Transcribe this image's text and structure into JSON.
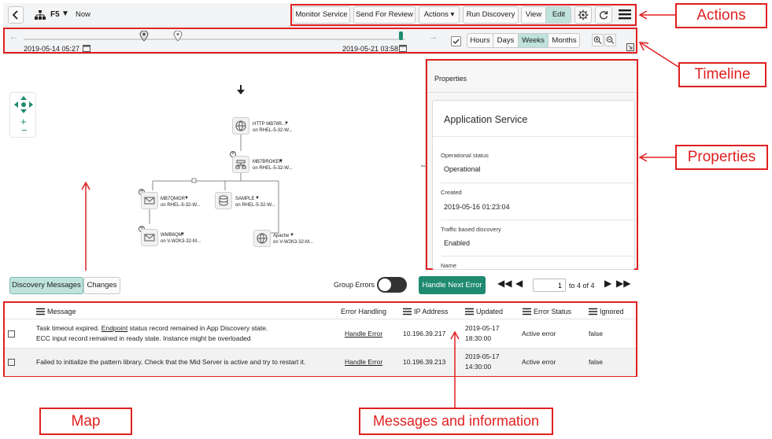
{
  "toolbar": {
    "back_icon": "chevron-left-icon",
    "hierarchy_icon": "hierarchy-icon",
    "service_name": "F5",
    "caret": "▼",
    "time_label": "Now",
    "buttons": {
      "monitor": "Monitor Service",
      "send_review": "Send For Review",
      "actions": "Actions ▾",
      "run_discovery": "Run Discovery",
      "view": "View",
      "edit": "Edit"
    },
    "icons": [
      "gear-icon",
      "refresh-icon",
      "menu-icon"
    ]
  },
  "timeline": {
    "start": "2019-05-14 05:27",
    "end": "2019-05-21 03:58",
    "scales": [
      "Hours",
      "Days",
      "Weeks",
      "Months"
    ],
    "active_scale": "Weeks"
  },
  "map": {
    "nodes": [
      {
        "name": "HTTP MB78R...",
        "host": "on RHEL-5-32-W..."
      },
      {
        "name": "MB7BROKER",
        "host": "on RHEL-5-32-W..."
      },
      {
        "name": "MB7QMGR",
        "host": "on RHEL-5-32-W..."
      },
      {
        "name": "SAMPLE",
        "host": "on RHEL-5-32-W..."
      },
      {
        "name": "WMB6QM",
        "host": "on V-W2K3-32-M..."
      },
      {
        "name": "Apache",
        "host": "on V-W2K3-32-M..."
      }
    ]
  },
  "properties": {
    "header": "Properties",
    "card_title": "Application Service",
    "fields": [
      {
        "label": "Operational status",
        "value": "Operational"
      },
      {
        "label": "Created",
        "value": "2019-05-16 01:23:04"
      },
      {
        "label": "Traffic based discovery",
        "value": "Enabled"
      },
      {
        "label": "Name",
        "value": ""
      }
    ]
  },
  "messages": {
    "tabs": [
      "Discovery Messages",
      "Changes"
    ],
    "active_tab": "Discovery Messages",
    "group_errors_label": "Group Errors",
    "handle_next_label": "Handle Next Error",
    "page_value": "1",
    "page_of": "to 4 of 4",
    "columns": [
      "Message",
      "Error Handling",
      "IP Address",
      "Updated",
      "Error Status",
      "Ignored"
    ],
    "rows": [
      {
        "message_line1_pre": "Task timeout expired. ",
        "message_link": "Endpoint",
        "message_line1_post": " status record remained in App Discovery state.",
        "message_line2": "ECC input record remained in ready state. Instance might be overloaded",
        "handling": "Handle Error",
        "ip": "10.196.39.217",
        "updated_date": "2019-05-17",
        "updated_time": "18:30:00",
        "status": "Active error",
        "ignored": "false"
      },
      {
        "message_line1_pre": "Failed to initialize the pattern library. Check that the Mid Server is active and try to restart it.",
        "message_link": "",
        "message_line1_post": "",
        "message_line2": "",
        "handling": "Handle Error",
        "ip": "10.196.39.213",
        "updated_date": "2019-05-17",
        "updated_time": "14:30:00",
        "status": "Active error",
        "ignored": "false"
      }
    ]
  },
  "annotations": {
    "actions": "Actions",
    "timeline": "Timeline",
    "properties": "Properties",
    "map": "Map",
    "messages": "Messages and information"
  },
  "colors": {
    "annotation_red": "#e02020",
    "accent_teal": "#1f8a70",
    "active_toggle": "#bfe3dc"
  }
}
